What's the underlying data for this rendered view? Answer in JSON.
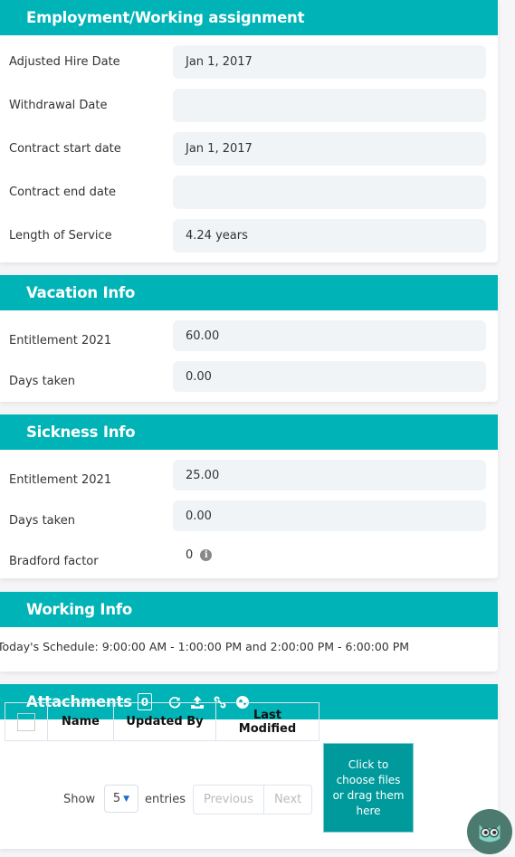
{
  "colors": {
    "header": "#00b3b6",
    "dropzone": "#009a9c",
    "field_bg": "#f1f4f7"
  },
  "employment": {
    "title": "Employment/Working assignment",
    "rows": [
      {
        "label": "Adjusted Hire Date",
        "value": "Jan 1, 2017"
      },
      {
        "label": "Withdrawal Date",
        "value": ""
      },
      {
        "label": "Contract start date",
        "value": "Jan 1, 2017"
      },
      {
        "label": "Contract end date",
        "value": ""
      },
      {
        "label": "Length of Service",
        "value": "4.24 years"
      }
    ]
  },
  "vacation": {
    "title": "Vacation Info",
    "rows": [
      {
        "label": "Entitlement 2021",
        "value": "60.00"
      },
      {
        "label": "Days taken",
        "value": "0.00"
      }
    ]
  },
  "sickness": {
    "title": "Sickness Info",
    "rows": [
      {
        "label": "Entitlement 2021",
        "value": "25.00"
      },
      {
        "label": "Days taken",
        "value": "0.00"
      },
      {
        "label": "Bradford factor",
        "value": "0",
        "icon": "info-icon"
      }
    ]
  },
  "working": {
    "title": "Working Info",
    "schedule": "Today's Schedule: 9:00:00 AM - 1:00:00 PM and 2:00:00 PM - 6:00:00 PM"
  },
  "attachments": {
    "title": "Attachments",
    "count": "0",
    "header_icons": [
      "refresh-icon",
      "upload-icon",
      "link-icon",
      "globe-icon"
    ],
    "columns": [
      "Name",
      "Updated By",
      "Last Modified"
    ],
    "show_label": "Show",
    "page_size": "5",
    "entries_label": "entries",
    "previous_label": "Previous",
    "next_label": "Next",
    "dropzone_text": "Click to choose files or drag them here"
  },
  "assistant": {
    "icon": "owl-assistant-icon"
  }
}
